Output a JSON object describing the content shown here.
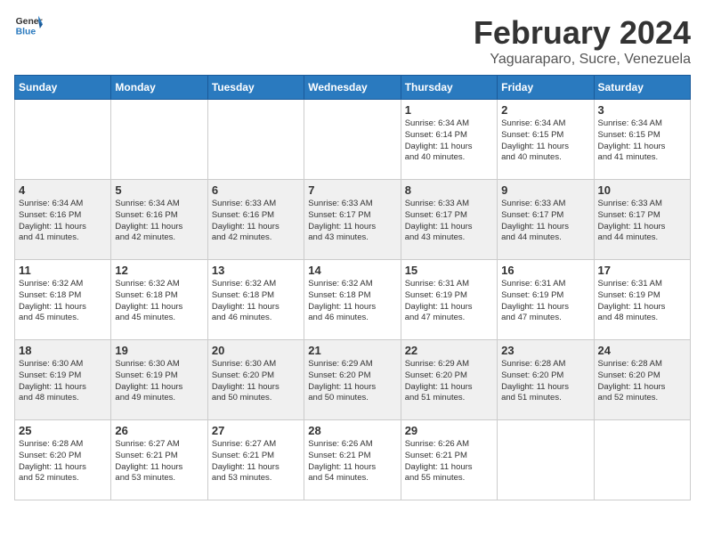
{
  "header": {
    "logo_general": "General",
    "logo_blue": "Blue",
    "title": "February 2024",
    "subtitle": "Yaguaraparo, Sucre, Venezuela"
  },
  "days_of_week": [
    "Sunday",
    "Monday",
    "Tuesday",
    "Wednesday",
    "Thursday",
    "Friday",
    "Saturday"
  ],
  "weeks": [
    [
      {
        "day": "",
        "info": ""
      },
      {
        "day": "",
        "info": ""
      },
      {
        "day": "",
        "info": ""
      },
      {
        "day": "",
        "info": ""
      },
      {
        "day": "1",
        "info": "Sunrise: 6:34 AM\nSunset: 6:14 PM\nDaylight: 11 hours\nand 40 minutes."
      },
      {
        "day": "2",
        "info": "Sunrise: 6:34 AM\nSunset: 6:15 PM\nDaylight: 11 hours\nand 40 minutes."
      },
      {
        "day": "3",
        "info": "Sunrise: 6:34 AM\nSunset: 6:15 PM\nDaylight: 11 hours\nand 41 minutes."
      }
    ],
    [
      {
        "day": "4",
        "info": "Sunrise: 6:34 AM\nSunset: 6:16 PM\nDaylight: 11 hours\nand 41 minutes."
      },
      {
        "day": "5",
        "info": "Sunrise: 6:34 AM\nSunset: 6:16 PM\nDaylight: 11 hours\nand 42 minutes."
      },
      {
        "day": "6",
        "info": "Sunrise: 6:33 AM\nSunset: 6:16 PM\nDaylight: 11 hours\nand 42 minutes."
      },
      {
        "day": "7",
        "info": "Sunrise: 6:33 AM\nSunset: 6:17 PM\nDaylight: 11 hours\nand 43 minutes."
      },
      {
        "day": "8",
        "info": "Sunrise: 6:33 AM\nSunset: 6:17 PM\nDaylight: 11 hours\nand 43 minutes."
      },
      {
        "day": "9",
        "info": "Sunrise: 6:33 AM\nSunset: 6:17 PM\nDaylight: 11 hours\nand 44 minutes."
      },
      {
        "day": "10",
        "info": "Sunrise: 6:33 AM\nSunset: 6:17 PM\nDaylight: 11 hours\nand 44 minutes."
      }
    ],
    [
      {
        "day": "11",
        "info": "Sunrise: 6:32 AM\nSunset: 6:18 PM\nDaylight: 11 hours\nand 45 minutes."
      },
      {
        "day": "12",
        "info": "Sunrise: 6:32 AM\nSunset: 6:18 PM\nDaylight: 11 hours\nand 45 minutes."
      },
      {
        "day": "13",
        "info": "Sunrise: 6:32 AM\nSunset: 6:18 PM\nDaylight: 11 hours\nand 46 minutes."
      },
      {
        "day": "14",
        "info": "Sunrise: 6:32 AM\nSunset: 6:18 PM\nDaylight: 11 hours\nand 46 minutes."
      },
      {
        "day": "15",
        "info": "Sunrise: 6:31 AM\nSunset: 6:19 PM\nDaylight: 11 hours\nand 47 minutes."
      },
      {
        "day": "16",
        "info": "Sunrise: 6:31 AM\nSunset: 6:19 PM\nDaylight: 11 hours\nand 47 minutes."
      },
      {
        "day": "17",
        "info": "Sunrise: 6:31 AM\nSunset: 6:19 PM\nDaylight: 11 hours\nand 48 minutes."
      }
    ],
    [
      {
        "day": "18",
        "info": "Sunrise: 6:30 AM\nSunset: 6:19 PM\nDaylight: 11 hours\nand 48 minutes."
      },
      {
        "day": "19",
        "info": "Sunrise: 6:30 AM\nSunset: 6:19 PM\nDaylight: 11 hours\nand 49 minutes."
      },
      {
        "day": "20",
        "info": "Sunrise: 6:30 AM\nSunset: 6:20 PM\nDaylight: 11 hours\nand 50 minutes."
      },
      {
        "day": "21",
        "info": "Sunrise: 6:29 AM\nSunset: 6:20 PM\nDaylight: 11 hours\nand 50 minutes."
      },
      {
        "day": "22",
        "info": "Sunrise: 6:29 AM\nSunset: 6:20 PM\nDaylight: 11 hours\nand 51 minutes."
      },
      {
        "day": "23",
        "info": "Sunrise: 6:28 AM\nSunset: 6:20 PM\nDaylight: 11 hours\nand 51 minutes."
      },
      {
        "day": "24",
        "info": "Sunrise: 6:28 AM\nSunset: 6:20 PM\nDaylight: 11 hours\nand 52 minutes."
      }
    ],
    [
      {
        "day": "25",
        "info": "Sunrise: 6:28 AM\nSunset: 6:20 PM\nDaylight: 11 hours\nand 52 minutes."
      },
      {
        "day": "26",
        "info": "Sunrise: 6:27 AM\nSunset: 6:21 PM\nDaylight: 11 hours\nand 53 minutes."
      },
      {
        "day": "27",
        "info": "Sunrise: 6:27 AM\nSunset: 6:21 PM\nDaylight: 11 hours\nand 53 minutes."
      },
      {
        "day": "28",
        "info": "Sunrise: 6:26 AM\nSunset: 6:21 PM\nDaylight: 11 hours\nand 54 minutes."
      },
      {
        "day": "29",
        "info": "Sunrise: 6:26 AM\nSunset: 6:21 PM\nDaylight: 11 hours\nand 55 minutes."
      },
      {
        "day": "",
        "info": ""
      },
      {
        "day": "",
        "info": ""
      }
    ]
  ]
}
